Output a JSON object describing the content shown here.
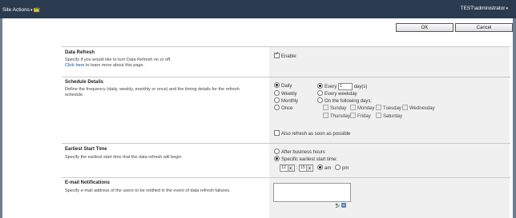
{
  "topbar": {
    "site_actions": "Site Actions",
    "user": "TEST\\administrator"
  },
  "toolbar": {
    "ok_label": "OK",
    "cancel_label": "Cancel"
  },
  "data_refresh": {
    "title": "Data Refresh",
    "desc": "Specify if you would like to turn Data Refresh on or off.",
    "link": "Click here",
    "link_suffix": " to learn more about this page.",
    "enable_label": "Enable",
    "enabled": true
  },
  "schedule": {
    "title": "Schedule Details",
    "desc": "Define the frequency (daily, weekly, monthly or once) and the timing details for the refresh schedule.",
    "frequencies": [
      "Daily",
      "Weekly",
      "Monthly",
      "Once"
    ],
    "every_label": "Every",
    "every_value": "1",
    "days_label": "day(s)",
    "every_weekday": "Every weekday",
    "following_days": "On the following days:",
    "days": [
      "Sunday",
      "Monday",
      "Tuesday",
      "Wednesday",
      "Thursday",
      "Friday",
      "Saturday"
    ],
    "also_refresh": "Also refresh as soon as possible"
  },
  "start_time": {
    "title": "Earliest Start Time",
    "desc": "Specify the earliest start time that the data refresh will begin",
    "after_hours": "After business hours",
    "specific": "Specific earliest start time:",
    "hour": "12",
    "minute": "15",
    "am": "am",
    "pm": "pm"
  },
  "email": {
    "title": "E-mail Notifications",
    "desc": "Specify e-mail address of the users to be notified in the event of data refresh failures."
  },
  "colors": {
    "topbar": "#2a3a4f",
    "link": "#0a4fa8",
    "panel": "#f0f0f0"
  }
}
